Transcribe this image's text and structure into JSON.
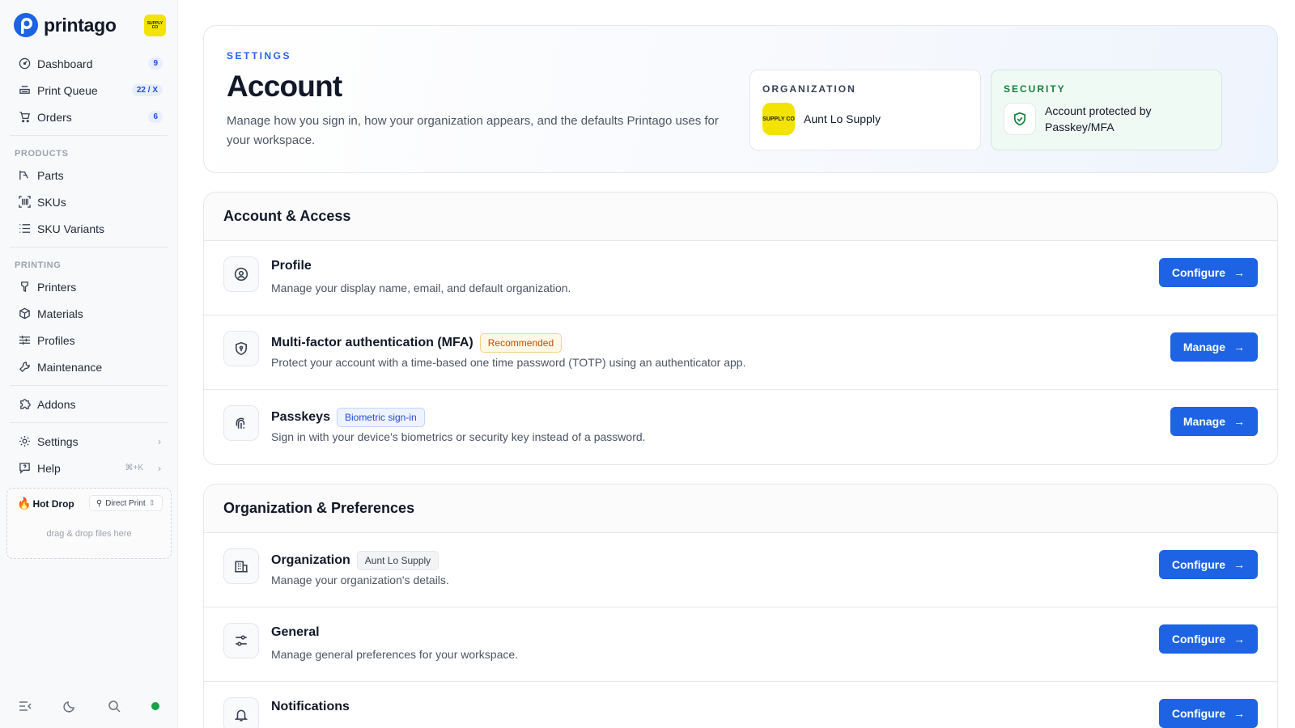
{
  "brand": {
    "name": "printago",
    "org_chip_text": "SUPPLY CO"
  },
  "nav": {
    "main": [
      {
        "label": "Dashboard",
        "badge": "9",
        "icon": "dashboard-icon"
      },
      {
        "label": "Print Queue",
        "badge": "22 / X",
        "icon": "print-queue-icon"
      },
      {
        "label": "Orders",
        "badge": "6",
        "icon": "cart-icon"
      }
    ],
    "products_label": "PRODUCTS",
    "products": [
      {
        "label": "Parts",
        "icon": "parts-icon"
      },
      {
        "label": "SKUs",
        "icon": "barcode-icon"
      },
      {
        "label": "SKU Variants",
        "icon": "list-icon"
      }
    ],
    "printing_label": "PRINTING",
    "printing": [
      {
        "label": "Printers",
        "icon": "printer-icon"
      },
      {
        "label": "Materials",
        "icon": "box-icon"
      },
      {
        "label": "Profiles",
        "icon": "sliders-icon"
      },
      {
        "label": "Maintenance",
        "icon": "wrench-icon"
      }
    ],
    "addons": "Addons",
    "settings": "Settings",
    "help": "Help",
    "help_shortcut": "⌘+K"
  },
  "hotdrop": {
    "title": "Hot Drop",
    "mode": "Direct Print",
    "hint": "drag & drop files here"
  },
  "hero": {
    "eyebrow": "SETTINGS",
    "title": "Account",
    "description": "Manage how you sign in, how your organization appears, and the defaults Printago uses for your workspace.",
    "org_label": "ORGANIZATION",
    "org_name": "Aunt Lo Supply",
    "org_avatar_text": "SUPPLY CO",
    "security_label": "SECURITY",
    "security_text": "Account protected by Passkey/MFA"
  },
  "sections": {
    "access": {
      "title": "Account & Access",
      "items": [
        {
          "title": "Profile",
          "desc": "Manage your display name, email, and default organization.",
          "action": "Configure"
        },
        {
          "title": "Multi-factor authentication (MFA)",
          "tag": "Recommended",
          "desc": "Protect your account with a time-based one time password (TOTP) using an authenticator app.",
          "action": "Manage"
        },
        {
          "title": "Passkeys",
          "tag": "Biometric sign-in",
          "desc": "Sign in with your device's biometrics or security key instead of a password.",
          "action": "Manage"
        }
      ]
    },
    "org": {
      "title": "Organization & Preferences",
      "items": [
        {
          "title": "Organization",
          "tag": "Aunt Lo Supply",
          "desc": "Manage your organization's details.",
          "action": "Configure"
        },
        {
          "title": "General",
          "desc": "Manage general preferences for your workspace.",
          "action": "Configure"
        },
        {
          "title": "Notifications",
          "action": "Configure"
        }
      ]
    }
  },
  "colors": {
    "accent": "#1d63e3",
    "brand_yellow": "#f2e300",
    "status_online": "#16a34a"
  }
}
